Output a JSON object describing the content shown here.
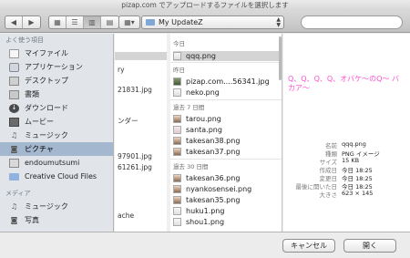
{
  "window": {
    "title": "pizap.com でアップロードするファイルを選択します"
  },
  "toolbar": {
    "back_icon": "chevron-left",
    "forward_icon": "chevron-right",
    "view_icons": [
      "icon-view",
      "list-view",
      "column-view",
      "coverflow-view"
    ],
    "arrange_icon": "grid-arrange",
    "location": "My UpdateZ"
  },
  "sidebar": {
    "favorites_header": "よく使う項目",
    "items": [
      {
        "label": "マイファイル",
        "icon": "document-icon"
      },
      {
        "label": "アプリケーション",
        "icon": "applications-icon"
      },
      {
        "label": "デスクトップ",
        "icon": "desktop-icon"
      },
      {
        "label": "書類",
        "icon": "books-icon"
      },
      {
        "label": "ダウンロード",
        "icon": "download-icon"
      },
      {
        "label": "ムービー",
        "icon": "movie-icon"
      },
      {
        "label": "ミュージック",
        "icon": "music-icon"
      },
      {
        "label": "ピクチャ",
        "icon": "camera-icon"
      },
      {
        "label": "endoumutsumi",
        "icon": "home-icon"
      },
      {
        "label": "Creative Cloud Files",
        "icon": "folder-icon"
      }
    ],
    "selected_index": 7,
    "media_header": "メディア",
    "media_items": [
      {
        "label": "ミュージック",
        "icon": "music-icon"
      },
      {
        "label": "写真",
        "icon": "camera-icon"
      }
    ]
  },
  "column1": {
    "fragments": [
      "ry",
      "21831.jpg",
      "ンダー",
      "97901.jpg",
      "61261.jpg",
      "ache"
    ]
  },
  "column2": {
    "sections": [
      {
        "header": "今日",
        "files": [
          {
            "name": "qqq.png",
            "type": "png",
            "selected": true
          }
        ]
      },
      {
        "header": "昨日",
        "files": [
          {
            "name": "pizap.com....56341.jpg",
            "type": "jpg"
          },
          {
            "name": "neko.png",
            "type": "png"
          }
        ]
      },
      {
        "header": "過去 7 日間",
        "files": [
          {
            "name": "tarou.png",
            "type": "face"
          },
          {
            "name": "santa.png",
            "type": "png"
          },
          {
            "name": "takesan38.png",
            "type": "face"
          },
          {
            "name": "takesan37.png",
            "type": "face"
          }
        ]
      },
      {
        "header": "過去 30 日間",
        "files": [
          {
            "name": "takesan36.png",
            "type": "face"
          },
          {
            "name": "nyankosensei.png",
            "type": "face"
          },
          {
            "name": "takesan35.png",
            "type": "face"
          },
          {
            "name": "huku1.png",
            "type": "png"
          },
          {
            "name": "shou1.png",
            "type": "png"
          }
        ]
      }
    ]
  },
  "preview": {
    "text": "Q、Q、Q、Q、オバケ〜のQ〜 バカア〜",
    "info": [
      {
        "key": "名前",
        "value": "qqq.png"
      },
      {
        "key": "種類",
        "value": "PNG イメージ"
      },
      {
        "key": "サイズ",
        "value": "15 KB"
      },
      {
        "key": "作成日",
        "value": "今日 18:25"
      },
      {
        "key": "変更日",
        "value": "今日 18:25"
      },
      {
        "key": "最後に開いた日",
        "value": "今日 18:25"
      },
      {
        "key": "大きさ",
        "value": "623 × 145"
      }
    ]
  },
  "buttons": {
    "cancel": "キャンセル",
    "open": "開く"
  }
}
